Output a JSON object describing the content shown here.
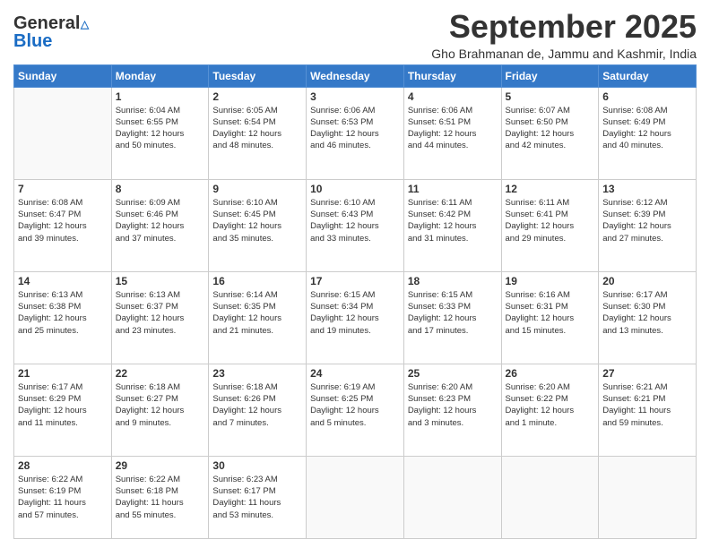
{
  "logo": {
    "general": "General",
    "blue": "Blue"
  },
  "title": "September 2025",
  "subtitle": "Gho Brahmanan de, Jammu and Kashmir, India",
  "headers": [
    "Sunday",
    "Monday",
    "Tuesday",
    "Wednesday",
    "Thursday",
    "Friday",
    "Saturday"
  ],
  "weeks": [
    [
      {
        "day": "",
        "info": ""
      },
      {
        "day": "1",
        "info": "Sunrise: 6:04 AM\nSunset: 6:55 PM\nDaylight: 12 hours\nand 50 minutes."
      },
      {
        "day": "2",
        "info": "Sunrise: 6:05 AM\nSunset: 6:54 PM\nDaylight: 12 hours\nand 48 minutes."
      },
      {
        "day": "3",
        "info": "Sunrise: 6:06 AM\nSunset: 6:53 PM\nDaylight: 12 hours\nand 46 minutes."
      },
      {
        "day": "4",
        "info": "Sunrise: 6:06 AM\nSunset: 6:51 PM\nDaylight: 12 hours\nand 44 minutes."
      },
      {
        "day": "5",
        "info": "Sunrise: 6:07 AM\nSunset: 6:50 PM\nDaylight: 12 hours\nand 42 minutes."
      },
      {
        "day": "6",
        "info": "Sunrise: 6:08 AM\nSunset: 6:49 PM\nDaylight: 12 hours\nand 40 minutes."
      }
    ],
    [
      {
        "day": "7",
        "info": "Sunrise: 6:08 AM\nSunset: 6:47 PM\nDaylight: 12 hours\nand 39 minutes."
      },
      {
        "day": "8",
        "info": "Sunrise: 6:09 AM\nSunset: 6:46 PM\nDaylight: 12 hours\nand 37 minutes."
      },
      {
        "day": "9",
        "info": "Sunrise: 6:10 AM\nSunset: 6:45 PM\nDaylight: 12 hours\nand 35 minutes."
      },
      {
        "day": "10",
        "info": "Sunrise: 6:10 AM\nSunset: 6:43 PM\nDaylight: 12 hours\nand 33 minutes."
      },
      {
        "day": "11",
        "info": "Sunrise: 6:11 AM\nSunset: 6:42 PM\nDaylight: 12 hours\nand 31 minutes."
      },
      {
        "day": "12",
        "info": "Sunrise: 6:11 AM\nSunset: 6:41 PM\nDaylight: 12 hours\nand 29 minutes."
      },
      {
        "day": "13",
        "info": "Sunrise: 6:12 AM\nSunset: 6:39 PM\nDaylight: 12 hours\nand 27 minutes."
      }
    ],
    [
      {
        "day": "14",
        "info": "Sunrise: 6:13 AM\nSunset: 6:38 PM\nDaylight: 12 hours\nand 25 minutes."
      },
      {
        "day": "15",
        "info": "Sunrise: 6:13 AM\nSunset: 6:37 PM\nDaylight: 12 hours\nand 23 minutes."
      },
      {
        "day": "16",
        "info": "Sunrise: 6:14 AM\nSunset: 6:35 PM\nDaylight: 12 hours\nand 21 minutes."
      },
      {
        "day": "17",
        "info": "Sunrise: 6:15 AM\nSunset: 6:34 PM\nDaylight: 12 hours\nand 19 minutes."
      },
      {
        "day": "18",
        "info": "Sunrise: 6:15 AM\nSunset: 6:33 PM\nDaylight: 12 hours\nand 17 minutes."
      },
      {
        "day": "19",
        "info": "Sunrise: 6:16 AM\nSunset: 6:31 PM\nDaylight: 12 hours\nand 15 minutes."
      },
      {
        "day": "20",
        "info": "Sunrise: 6:17 AM\nSunset: 6:30 PM\nDaylight: 12 hours\nand 13 minutes."
      }
    ],
    [
      {
        "day": "21",
        "info": "Sunrise: 6:17 AM\nSunset: 6:29 PM\nDaylight: 12 hours\nand 11 minutes."
      },
      {
        "day": "22",
        "info": "Sunrise: 6:18 AM\nSunset: 6:27 PM\nDaylight: 12 hours\nand 9 minutes."
      },
      {
        "day": "23",
        "info": "Sunrise: 6:18 AM\nSunset: 6:26 PM\nDaylight: 12 hours\nand 7 minutes."
      },
      {
        "day": "24",
        "info": "Sunrise: 6:19 AM\nSunset: 6:25 PM\nDaylight: 12 hours\nand 5 minutes."
      },
      {
        "day": "25",
        "info": "Sunrise: 6:20 AM\nSunset: 6:23 PM\nDaylight: 12 hours\nand 3 minutes."
      },
      {
        "day": "26",
        "info": "Sunrise: 6:20 AM\nSunset: 6:22 PM\nDaylight: 12 hours\nand 1 minute."
      },
      {
        "day": "27",
        "info": "Sunrise: 6:21 AM\nSunset: 6:21 PM\nDaylight: 11 hours\nand 59 minutes."
      }
    ],
    [
      {
        "day": "28",
        "info": "Sunrise: 6:22 AM\nSunset: 6:19 PM\nDaylight: 11 hours\nand 57 minutes."
      },
      {
        "day": "29",
        "info": "Sunrise: 6:22 AM\nSunset: 6:18 PM\nDaylight: 11 hours\nand 55 minutes."
      },
      {
        "day": "30",
        "info": "Sunrise: 6:23 AM\nSunset: 6:17 PM\nDaylight: 11 hours\nand 53 minutes."
      },
      {
        "day": "",
        "info": ""
      },
      {
        "day": "",
        "info": ""
      },
      {
        "day": "",
        "info": ""
      },
      {
        "day": "",
        "info": ""
      }
    ]
  ]
}
